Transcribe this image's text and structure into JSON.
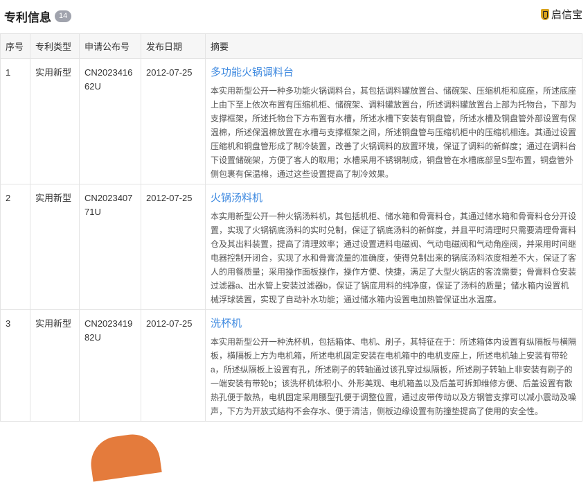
{
  "header": {
    "title": "专利信息",
    "count": "14",
    "brand": "启信宝"
  },
  "columns": [
    "序号",
    "专利类型",
    "申请公布号",
    "发布日期",
    "摘要"
  ],
  "rows": [
    {
      "index": "1",
      "type": "实用新型",
      "number": "CN202341662U",
      "date": "2012-07-25",
      "name": "多功能火锅调料台",
      "abstract": "本实用新型公开一种多功能火锅调料台，其包括调料罐放置台、储碗架、压缩机柜和底座，所述底座上由下至上依次布置有压缩机柜、储碗架、调料罐放置台，所述调料罐放置台上部为托物台，下部为支撑框架，所述托物台下方布置有水槽，所述水槽下安装有铜盘管，所述水槽及铜盘管外部设置有保温棉，所述保温棉放置在水槽与支撑框架之间，所述铜盘管与压缩机柜中的压缩机相连。其通过设置压缩机和铜盘管形成了制冷装置，改善了火锅调料的放置环境，保证了调料的新鲜度；通过在调料台下设置储碗架，方便了客人的取用；水槽采用不锈钢制成，铜盘管在水槽底部呈S型布置，铜盘管外侧包裹有保温棉，通过这些设置提高了制冷效果。"
    },
    {
      "index": "2",
      "type": "实用新型",
      "number": "CN202340771U",
      "date": "2012-07-25",
      "name": "火锅汤料机",
      "abstract": "本实用新型公开一种火锅汤料机，其包括机柜、储水箱和骨膏料仓，其通过储水箱和骨膏料仓分开设置，实现了火锅锅底汤料的实时兑制，保证了锅底汤料的新鲜度，并且平时清理时只需要清理骨膏料仓及其出料装置，提高了清理效率；通过设置进料电磁阀、气动电磁阀和气动角座阀，并采用时间继电器控制开闭合，实现了水和骨膏流量的准确度，使得兑制出来的锅底汤料浓度相差不大，保证了客人的用餐质量；采用操作面板操作，操作方便、快捷，满足了大型火锅店的客流需要；骨膏料仓安装过滤器a、出水管上安装过滤器b，保证了锅底用料的纯净度，保证了汤料的质量；储水箱内设置机械浮球装置，实现了自动补水功能；通过储水箱内设置电加热管保证出水温度。"
    },
    {
      "index": "3",
      "type": "实用新型",
      "number": "CN202341982U",
      "date": "2012-07-25",
      "name": "洗杯机",
      "abstract": "本实用新型公开一种洗杯机，包括箱体、电机、刷子，其特征在于：所述箱体内设置有纵隔板与横隔板，横隔板上方为电机箱，所述电机固定安装在电机箱中的电机支座上，所述电机轴上安装有带轮a，所述纵隔板上设置有孔，所述刷子的转轴通过该孔穿过纵隔板，所述刷子转轴上非安装有刷子的一端安装有带轮b；该洗杯机体积小、外形美观、电机箱盖以及后盖可拆卸维修方便、后盖设置有散热孔便于散热，电机固定采用腰型孔便于调整位置，通过皮带传动以及方钢管支撑可以减小震动及噪声，下方为开放式结构不会存水、便于清洁，侧板边缘设置有防撞垫提高了使用的安全性。"
    }
  ]
}
